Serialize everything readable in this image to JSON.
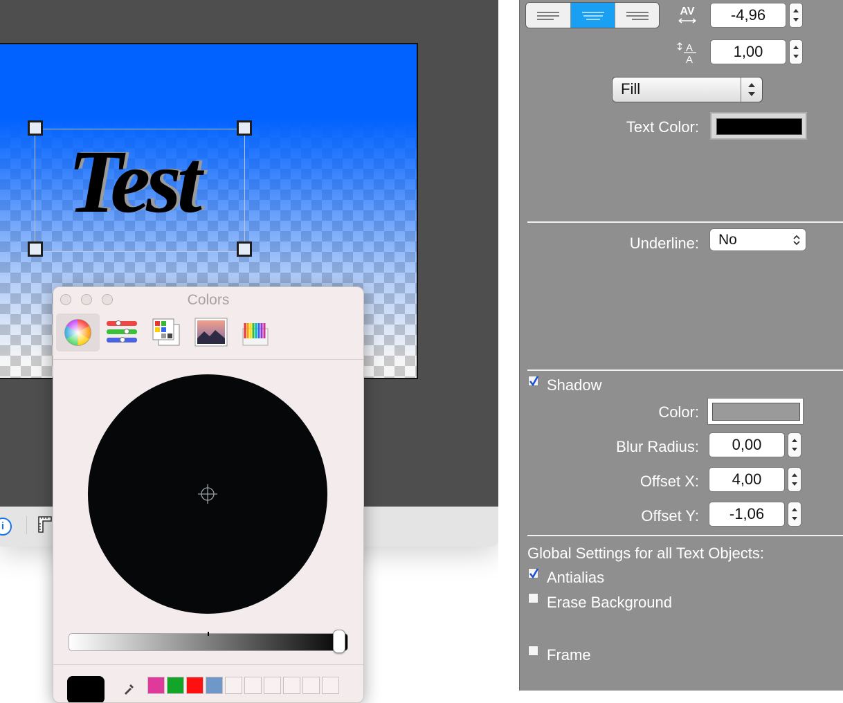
{
  "canvas": {
    "sample_text": "Test"
  },
  "colors_panel": {
    "title": "Colors",
    "tabs": [
      "color-wheel",
      "color-sliders",
      "color-palettes",
      "image-palettes",
      "pencils"
    ],
    "swatches": [
      "#e0399c",
      "#13a52a",
      "#ff1010",
      "#6e98c8",
      "",
      "",
      "",
      "",
      "",
      ""
    ]
  },
  "inspector": {
    "char_spacing": "-4,96",
    "line_spacing": "1,00",
    "fill_mode": "Fill",
    "text_color_label": "Text Color:",
    "text_color": "#000000",
    "underline_label": "Underline:",
    "underline_value": "No",
    "shadow": {
      "label": "Shadow",
      "checked": true,
      "color_label": "Color:",
      "color": "#9a9a9a",
      "blur_label": "Blur Radius:",
      "blur_value": "0,00",
      "offset_x_label": "Offset X:",
      "offset_x_value": "4,00",
      "offset_y_label": "Offset Y:",
      "offset_y_value": "-1,06"
    },
    "global": {
      "title": "Global Settings for all Text Objects:",
      "antialias_label": "Antialias",
      "antialias_checked": true,
      "erase_label": "Erase Background",
      "erase_checked": false,
      "frame_label": "Frame",
      "frame_checked": false
    }
  }
}
